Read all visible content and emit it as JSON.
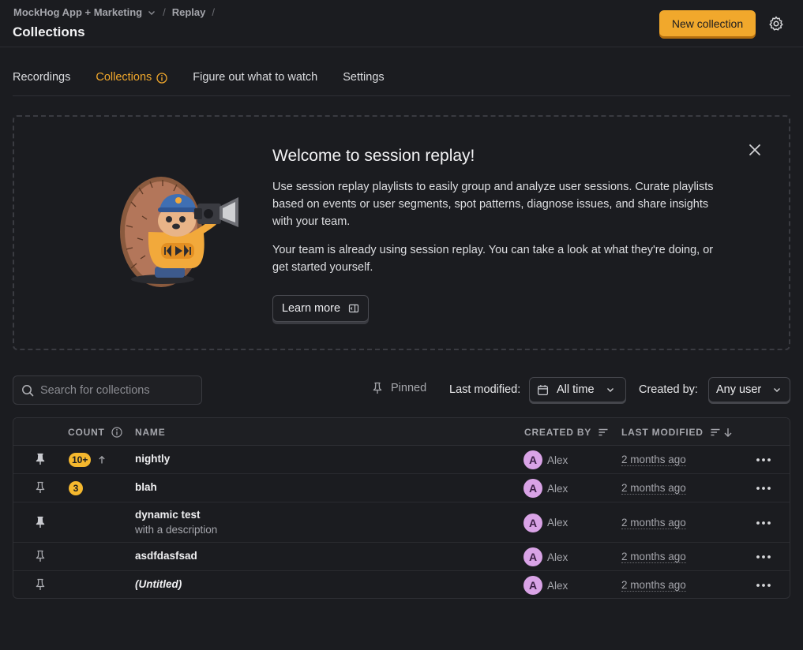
{
  "header": {
    "org_name": "MockHog App + Marketing",
    "breadcrumb_replay": "Replay",
    "page_title": "Collections",
    "new_button": "New collection"
  },
  "tabs": [
    {
      "label": "Recordings"
    },
    {
      "label": "Collections"
    },
    {
      "label": "Figure out what to watch"
    },
    {
      "label": "Settings"
    }
  ],
  "welcome": {
    "title": "Welcome to session replay!",
    "paragraph1": "Use session replay playlists to easily group and analyze user sessions. Curate playlists based on events or user segments, spot patterns, diagnose issues, and share insights with your team.",
    "paragraph2": "Your team is already using session replay. You can take a look at what they're doing, or get started yourself.",
    "learn_more": "Learn more"
  },
  "filters": {
    "search_placeholder": "Search for collections",
    "pinned_label": "Pinned",
    "last_modified_label": "Last modified:",
    "last_modified_value": "All time",
    "created_by_label": "Created by:",
    "created_by_value": "Any user"
  },
  "table": {
    "headers": {
      "count": "COUNT",
      "name": "NAME",
      "created_by": "CREATED BY",
      "last_modified": "LAST MODIFIED"
    },
    "rows": [
      {
        "pinned": true,
        "count": "10+",
        "trend_up": true,
        "name": "nightly",
        "description": "",
        "avatar": "A",
        "author": "Alex",
        "modified": "2 months ago"
      },
      {
        "pinned": false,
        "count": "3",
        "trend_up": false,
        "name": "blah",
        "description": "",
        "avatar": "A",
        "author": "Alex",
        "modified": "2 months ago"
      },
      {
        "pinned": true,
        "count": "",
        "trend_up": false,
        "name": "dynamic test",
        "description": "with a description",
        "avatar": "A",
        "author": "Alex",
        "modified": "2 months ago"
      },
      {
        "pinned": false,
        "count": "",
        "trend_up": false,
        "name": "asdfdasfsad",
        "description": "",
        "avatar": "A",
        "author": "Alex",
        "modified": "2 months ago"
      },
      {
        "pinned": false,
        "count": "",
        "trend_up": false,
        "name": "(Untitled)",
        "description": "",
        "avatar": "A",
        "author": "Alex",
        "modified": "2 months ago"
      }
    ]
  },
  "colors": {
    "accent": "#f1a82c",
    "background": "#1b1c20",
    "badge": "#f5b82e",
    "avatar": "#d9a3e6"
  }
}
